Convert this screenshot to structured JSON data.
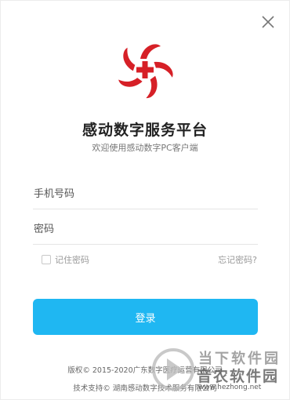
{
  "header": {
    "title": "感动数字服务平台",
    "subtitle": "欢迎使用感动数字PC客户端"
  },
  "form": {
    "phone_placeholder": "手机号码",
    "password_placeholder": "密码",
    "remember_label": "记住密码",
    "forgot_label": "忘记密码?",
    "login_label": "登录"
  },
  "footer": {
    "copyright": "版权© 2015-2020广东数字医疗运营有限公司",
    "support": "技术支持© 湖南感动数字技术服务有限公司"
  },
  "watermark": {
    "line1": "当下软件园",
    "line2": "音农软件园",
    "url": "www.hezhong.net"
  },
  "colors": {
    "brand_red": "#d62027",
    "button_blue": "#1fb7f2"
  },
  "icons": {
    "logo": "red-cross-flower-logo",
    "close": "close-icon"
  }
}
